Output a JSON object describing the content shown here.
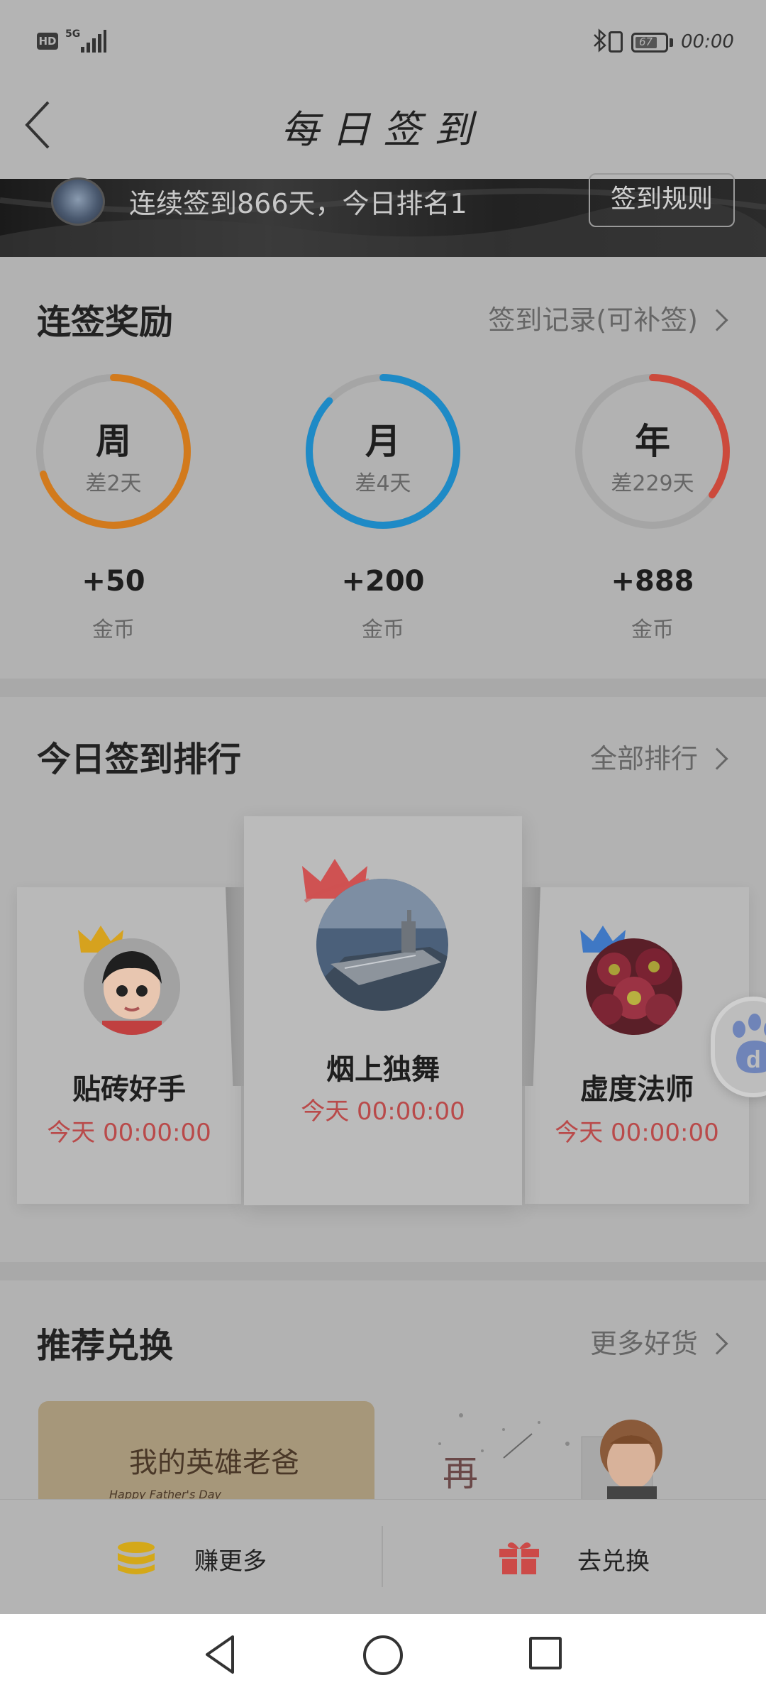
{
  "status_bar": {
    "hd": "HD",
    "network": "5G",
    "battery": "67",
    "time": "00:00"
  },
  "header": {
    "title": "每日签到"
  },
  "banner": {
    "text": "连续签到866天，今日排名1",
    "rules_button": "签到规则"
  },
  "streak": {
    "title": "连签奖励",
    "link": "签到记录(可补签)",
    "rings": [
      {
        "label": "周",
        "sub": "差2天",
        "reward": "+50",
        "unit": "金币",
        "color": "#d27a1c",
        "progress": 0.7
      },
      {
        "label": "月",
        "sub": "差4天",
        "reward": "+200",
        "unit": "金币",
        "color": "#1e8ac6",
        "progress": 0.87
      },
      {
        "label": "年",
        "sub": "差229天",
        "reward": "+888",
        "unit": "金币",
        "color": "#cc4a3c",
        "progress": 0.35
      }
    ]
  },
  "ranking": {
    "title": "今日签到排行",
    "link": "全部排行",
    "users": [
      {
        "name": "贴砖好手",
        "time": "今天 00:00:00",
        "crown_color": "#d6a21e"
      },
      {
        "name": "烟上独舞",
        "time": "今天 00:00:00",
        "crown_color": "#cf5252"
      },
      {
        "name": "虚度法师",
        "time": "今天 00:00:00",
        "crown_color": "#3f78c4"
      }
    ]
  },
  "exchange": {
    "title": "推荐兑换",
    "link": "更多好货",
    "card1_text": "我的英雄老爸",
    "card1_sub": "Happy Father's Day",
    "card2_text": "再"
  },
  "bottom_bar": {
    "earn": "赚更多",
    "exchange": "去兑换"
  }
}
